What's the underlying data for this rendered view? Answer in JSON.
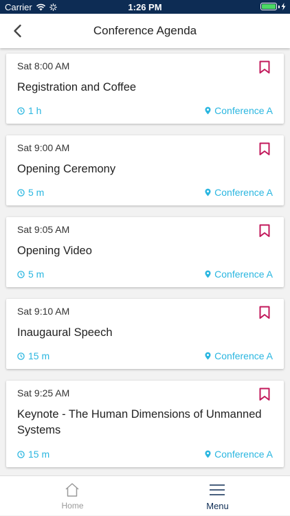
{
  "status_bar": {
    "carrier": "Carrier",
    "time": "1:26 PM",
    "battery_level": 1.0
  },
  "nav": {
    "title": "Conference Agenda",
    "back_icon": "chevron-left-icon"
  },
  "colors": {
    "status_bar_bg": "#0d2c54",
    "accent": "#29b6e0",
    "bookmark": "#c2185b",
    "tab_active": "#0d2c54",
    "tab_inactive": "#999999"
  },
  "sessions": [
    {
      "time": "Sat 8:00 AM",
      "title": "Registration and Coffee",
      "duration": "1 h",
      "location": "Conference A"
    },
    {
      "time": "Sat 9:00 AM",
      "title": "Opening Ceremony",
      "duration": "5 m",
      "location": "Conference A"
    },
    {
      "time": "Sat 9:05 AM",
      "title": "Opening Video",
      "duration": "5 m",
      "location": "Conference A"
    },
    {
      "time": "Sat 9:10 AM",
      "title": "Inaugaural Speech",
      "duration": "15 m",
      "location": "Conference A"
    },
    {
      "time": "Sat 9:25 AM",
      "title": "Keynote - The Human Dimensions of Unmanned Systems",
      "duration": "15 m",
      "location": "Conference A"
    }
  ],
  "tabs": [
    {
      "label": "Home",
      "icon": "home-icon",
      "active": false
    },
    {
      "label": "Menu",
      "icon": "menu-icon",
      "active": true
    }
  ]
}
